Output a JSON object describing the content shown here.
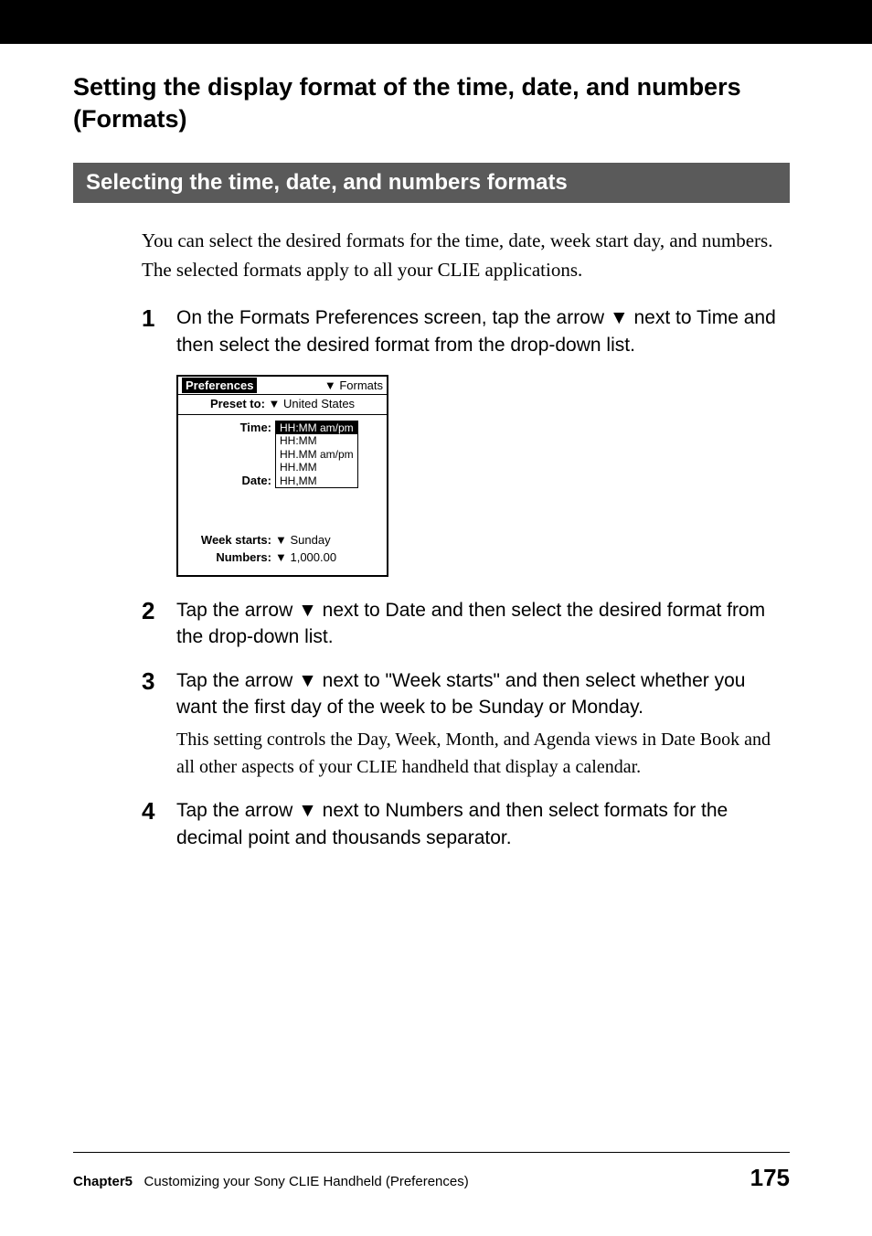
{
  "heading": "Setting the display format of the time, date, and numbers (Formats)",
  "subheading": "Selecting the time, date, and numbers formats",
  "intro": "You can select the desired formats for the time, date, week start day, and numbers. The selected formats apply to all your CLIE applications.",
  "steps": [
    {
      "num": "1",
      "instruction": "On the Formats Preferences screen, tap the arrow ▼ next to Time and then select the desired format from the drop-down list."
    },
    {
      "num": "2",
      "instruction": "Tap the arrow ▼ next to Date and then select the desired format from the drop-down list."
    },
    {
      "num": "3",
      "instruction": "Tap the arrow ▼ next to \"Week starts\" and then select whether you want the first day of the week to be Sunday or Monday.",
      "detail": "This setting controls the Day, Week, Month, and Agenda views in Date Book and all other aspects of your CLIE handheld that display a calendar."
    },
    {
      "num": "4",
      "instruction": "Tap the arrow ▼ next to Numbers and then select formats for the decimal point and thousands separator."
    }
  ],
  "screenshot": {
    "header_left": "Preferences",
    "header_right": "▼ Formats",
    "preset_label": "Preset to:",
    "preset_value": "▼ United States",
    "time_label": "Time:",
    "time_options": [
      "HH:MM am/pm",
      "HH:MM",
      "HH.MM am/pm",
      "HH.MM",
      "HH,MM"
    ],
    "date_label": "Date:",
    "weekstarts_label": "Week starts:",
    "weekstarts_value": "▼ Sunday",
    "numbers_label": "Numbers:",
    "numbers_value": "▼ 1,000.00"
  },
  "footer": {
    "chapter": "Chapter5",
    "chapter_text": "Customizing your Sony CLIE Handheld (Preferences)",
    "page": "175"
  }
}
